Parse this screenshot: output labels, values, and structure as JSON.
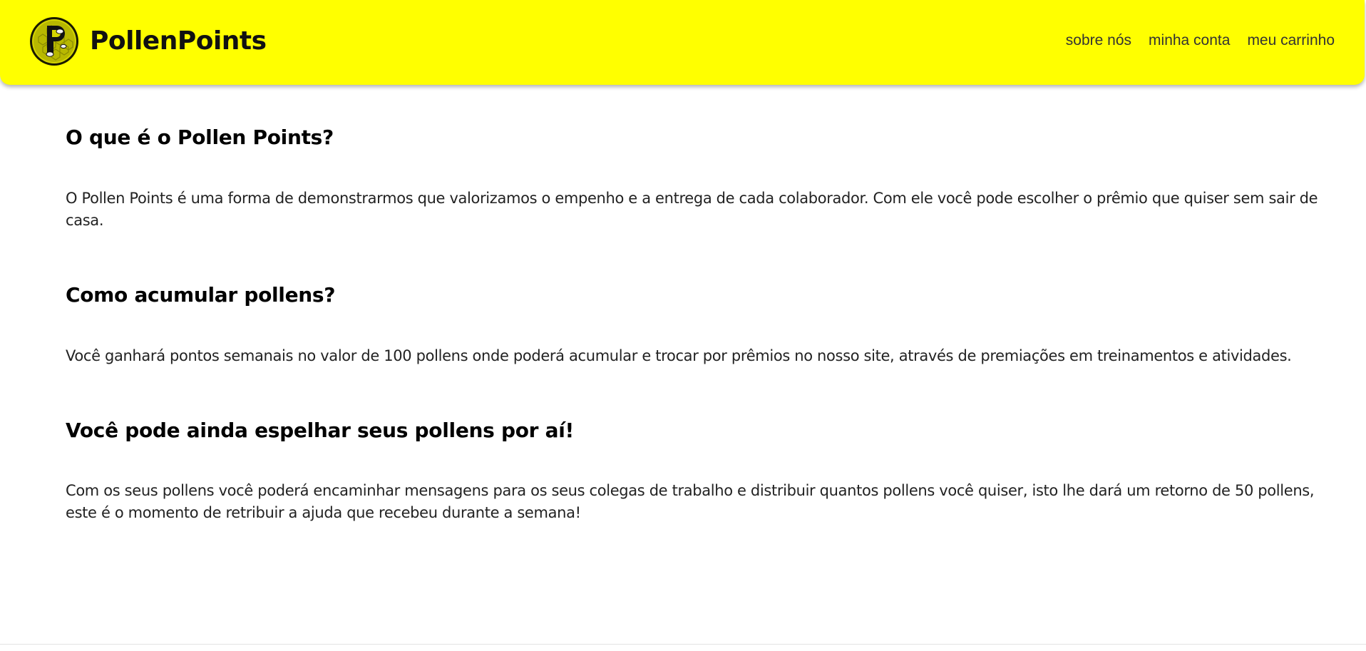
{
  "brand": {
    "name": "PollenPoints",
    "logo_icon": "pollen-coin-logo-icon"
  },
  "nav": {
    "links": [
      {
        "label": "sobre nós"
      },
      {
        "label": "minha conta"
      },
      {
        "label": "meu carrinho"
      }
    ]
  },
  "sections": [
    {
      "title": "O que é o Pollen Points?",
      "text": "O Pollen Points é uma forma de demonstrarmos que valorizamos o empenho e a entrega de cada colaborador. Com ele você pode escolher o prêmio que quiser sem sair de casa."
    },
    {
      "title": "Como acumular pollens?",
      "text": "Você ganhará pontos semanais no valor de 100 pollens onde poderá acumular e trocar por prêmios no nosso site, através de premiações em treinamentos e atividades."
    },
    {
      "title": "Você pode ainda espelhar seus pollens por aí!",
      "text": "Com os seus pollens você poderá encaminhar mensagens para os seus colegas de trabalho e distribuir quantos pollens você quiser, isto lhe dará um retorno de 50 pollens, este é o momento de retribuir a ajuda que recebeu durante a semana!"
    }
  ],
  "colors": {
    "navbar_background": "#ffff00",
    "text": "#111111",
    "nav_link": "#333333"
  }
}
